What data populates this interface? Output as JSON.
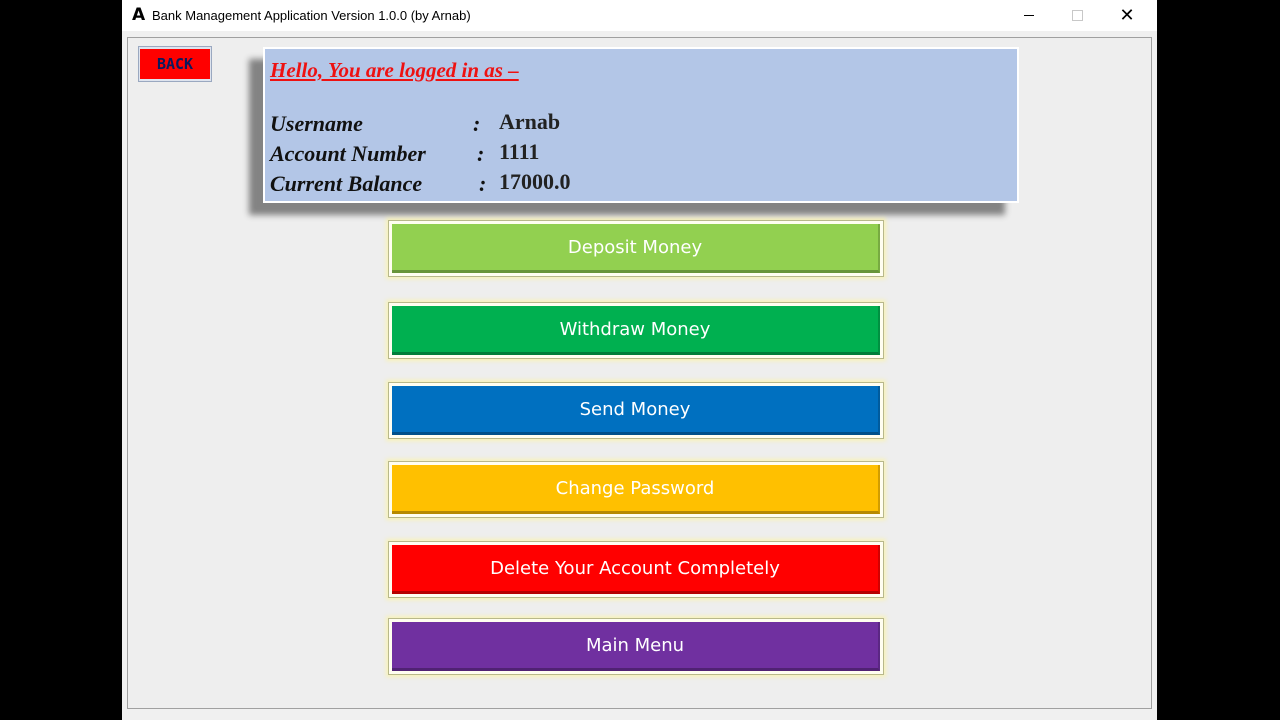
{
  "window": {
    "title": "Bank Management Application Version 1.0.0 (by Arnab)",
    "icon": "A"
  },
  "back_button": {
    "label": "BACK",
    "color": "#ff0000"
  },
  "info": {
    "greeting": "Hello, You are logged in as –",
    "rows": [
      {
        "label": "Username",
        "value": "Arnab"
      },
      {
        "label": "Account Number",
        "value": "1111"
      },
      {
        "label": "Current Balance",
        "value": "17000.0"
      }
    ],
    "separator": ":"
  },
  "actions": [
    {
      "label": "Deposit Money",
      "color": "#92d050"
    },
    {
      "label": "Withdraw Money",
      "color": "#00b050"
    },
    {
      "label": "Send Money",
      "color": "#0070c0"
    },
    {
      "label": "Change Password",
      "color": "#ffc000"
    },
    {
      "label": "Delete Your Account Completely",
      "color": "#ff0000"
    },
    {
      "label": "Main Menu",
      "color": "#7030a0"
    }
  ]
}
